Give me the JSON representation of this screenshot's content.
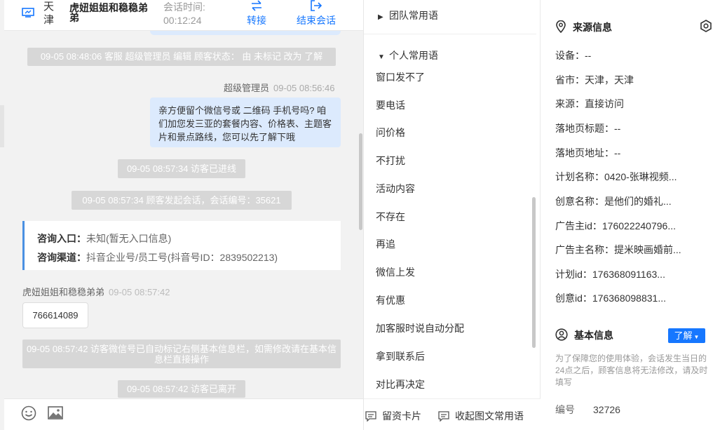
{
  "chat_header": {
    "city": "天津",
    "customer_name": "虎妞姐姐和稳稳弟弟",
    "session_time_label": "会话时间:",
    "session_time_value": "00:12:24",
    "transfer_label": "转接",
    "end_label": "结束会话"
  },
  "messages": {
    "sys1": "09-05 08:48:06 客服 超级管理员 编辑 顾客状态： 由 未标记 改为 了解",
    "admin_name": "超级管理员",
    "admin_time": "09-05 08:56:46",
    "agent_text": "亲方便留个微信号或 二维码 手机号吗? 咱们加您发三亚的套餐内容、价格表、主题客片和景点路线，您可以先了解下哦",
    "sys2": "09-05 08:57:34 访客已进线",
    "sys3": "09-05 08:57:34 顾客发起会话，会话编号：35621",
    "entry_label": "咨询入口：",
    "entry_value": "未知(暂无入口信息)",
    "channel_label": "咨询渠道：",
    "channel_value": "抖音企业号/员工号(抖音号ID：2839502213)",
    "visitor_name": "虎妞姐姐和稳稳弟弟",
    "visitor_time": "09-05 08:57:42",
    "visitor_text": "766614089",
    "sys4": "09-05 08:57:42 访客微信号已自动标记右侧基本信息栏，如需修改请在基本信息栏直接操作",
    "sys5": "09-05 08:57:42 访客已离开"
  },
  "phrases": {
    "team_title": "团队常用语",
    "personal_title": "个人常用语",
    "items": [
      "窗口发不了",
      "要电话",
      "问价格",
      "不打扰",
      "活动内容",
      "不存在",
      "再追",
      "微信上发",
      "有优惠",
      "加客服时说自动分配",
      "拿到联系后",
      "对比再决定"
    ],
    "card_label": "留资卡片",
    "collapse_label": "收起图文常用语"
  },
  "source_info": {
    "title": "来源信息",
    "rows": [
      "设备：--",
      "省市：天津，天津",
      "来源：直接访问",
      "落地页标题：--",
      "落地页地址：--",
      "计划名称：0420-张琳视频...",
      "创意名称：是他们的婚礼...",
      "广告主id：176022240796...",
      "广告主名称：提米映画婚前...",
      "计划id：176368091163...",
      "创意id：176368098831..."
    ]
  },
  "basic_info": {
    "title": "基本信息",
    "status_button": "了解",
    "note": "为了保障您的使用体验，会话发生当日的24点之后，顾客信息将无法修改，请及时填写",
    "number_label": "编号",
    "number_value": "32726"
  },
  "colors": {
    "accent": "#1677ff",
    "system_msg_bg": "#d7d7d7",
    "agent_bubble_bg": "#dceafd"
  }
}
